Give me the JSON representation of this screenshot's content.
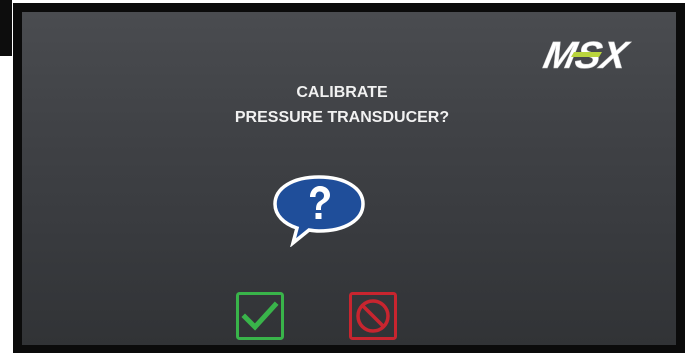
{
  "logo": {
    "text": "MSX",
    "accent_color": "#b9d43c",
    "text_color": "#ffffff"
  },
  "prompt": {
    "line1": "CALIBRATE",
    "line2": "PRESSURE TRANSDUCER?"
  },
  "icons": {
    "question": "question-speech-bubble-icon",
    "confirm": "checkmark-icon",
    "cancel": "prohibited-icon"
  },
  "colors": {
    "question_blue": "#1f4e9a",
    "confirm_green": "#39b44a",
    "cancel_red": "#c8252f"
  }
}
